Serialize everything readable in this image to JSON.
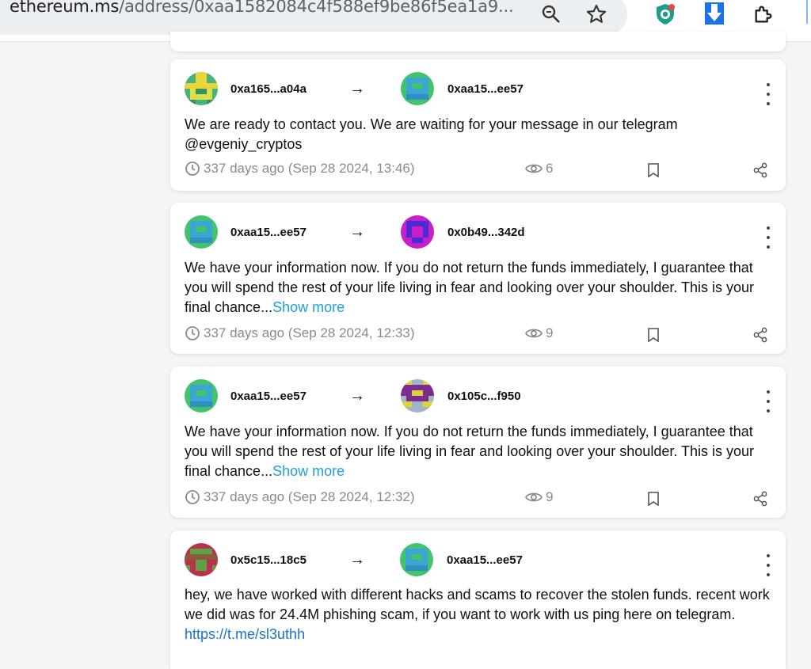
{
  "browser": {
    "url_domain": "ethereum.ms",
    "url_path": "/address/0xaa1582084c4f588ef9be86f5ea1a9..."
  },
  "messages": [
    {
      "from": "0xa165...a04a",
      "to": "0xaa15...ee57",
      "text": "We are ready to contact you. We are waiting for your message in our telegram @evgeniy_cryptos",
      "more": "",
      "time": "337 days ago (Sep 28 2024, 13:46)",
      "views": "6"
    },
    {
      "from": "0xaa15...ee57",
      "to": "0x0b49...342d",
      "text": "We have your information now. If you do not return the funds immediately, I guarantee that you will spend the rest of your life living in fear and looking over your shoulder. This is your final chance...",
      "more": "Show more",
      "time": "337 days ago (Sep 28 2024, 12:33)",
      "views": "9"
    },
    {
      "from": "0xaa15...ee57",
      "to": "0x105c...f950",
      "text": "We have your information now. If you do not return the funds immediately, I guarantee that you will spend the rest of your life living in fear and looking over your shoulder. This is your final chance...",
      "more": "Show more",
      "time": "337 days ago (Sep 28 2024, 12:32)",
      "views": "9"
    },
    {
      "from": "0x5c15...18c5",
      "to": "0xaa15...ee57",
      "text": "hey, we have worked with different hacks and scams to recover the stolen funds. recent work we did was for 24.4M phishing scam, if you want to work with us ping here on telegram. ",
      "link": "https://t.me/sl3uthh",
      "time": "",
      "views": ""
    }
  ],
  "arrow": "→",
  "colors": {
    "accent": "#1ea0db",
    "muted": "#8a8a8a"
  },
  "icons": [
    "zoom-icon",
    "star-icon",
    "shield-extension-icon",
    "download-icon",
    "puzzle-extension-icon",
    "clock-icon",
    "eye-icon",
    "bookmark-icon",
    "share-icon",
    "kebab-menu-icon"
  ]
}
